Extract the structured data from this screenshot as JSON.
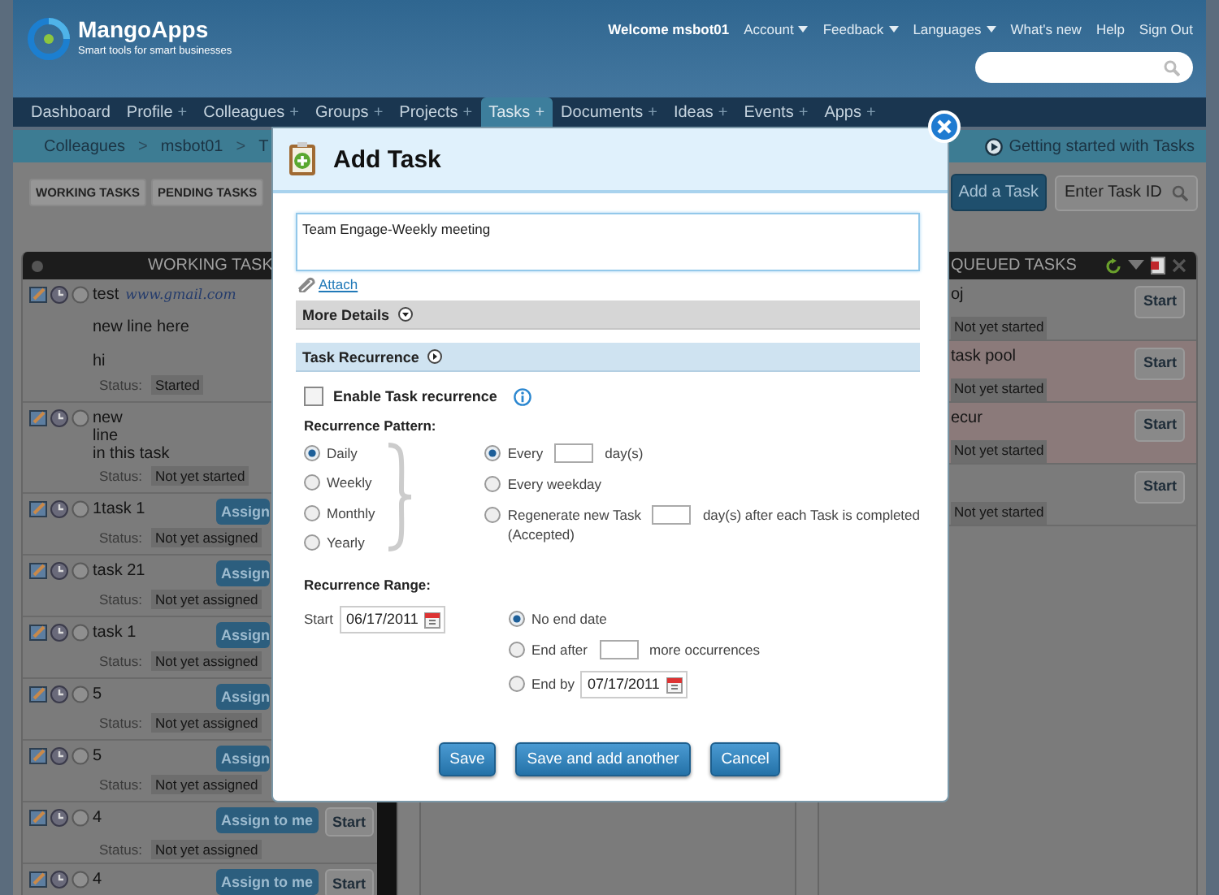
{
  "header": {
    "logo": {
      "name": "MangoApps",
      "tagline": "Smart tools for smart businesses"
    },
    "welcome": "Welcome",
    "user": "msbot01",
    "links": [
      {
        "label": "Account",
        "dropdown": true
      },
      {
        "label": "Feedback",
        "dropdown": true
      },
      {
        "label": "Languages",
        "dropdown": true
      },
      {
        "label": "What's new",
        "dropdown": false
      },
      {
        "label": "Help",
        "dropdown": false
      },
      {
        "label": "Sign Out",
        "dropdown": false
      }
    ]
  },
  "nav": [
    {
      "label": "Dashboard",
      "selected": false
    },
    {
      "label": "Profile",
      "plus": "+",
      "selected": false
    },
    {
      "label": "Colleagues",
      "plus": "+",
      "selected": false
    },
    {
      "label": "Groups",
      "plus": "+",
      "selected": false
    },
    {
      "label": "Projects",
      "plus": "+",
      "selected": false
    },
    {
      "label": "Tasks",
      "plus": "+",
      "selected": true
    },
    {
      "label": "Documents",
      "plus": "+",
      "selected": false
    },
    {
      "label": "Ideas",
      "plus": "+",
      "selected": false
    },
    {
      "label": "Events",
      "plus": "+",
      "selected": false
    },
    {
      "label": "Apps",
      "plus": "+",
      "selected": false
    }
  ],
  "breadcrumb": [
    {
      "kind": "link",
      "label": "Colleagues"
    },
    {
      "kind": "sep",
      "label": ">"
    },
    {
      "kind": "link",
      "label": "msbot01"
    },
    {
      "kind": "sep",
      "label": ">"
    },
    {
      "kind": "link",
      "label": "T"
    }
  ],
  "getting_started": "Getting started with Tasks",
  "toolbar": {
    "views": [
      "WORKING TASKS",
      "PENDING TASKS"
    ],
    "add_button": "Add a Task",
    "task_id": {
      "placeholder": "Enter Task ID"
    }
  },
  "working_panel": {
    "title": "WORKING TASK",
    "tasks": [
      {
        "title": "test",
        "link": "www.gmail.com",
        "description": "new line here\n\nhi",
        "status_label": "Status:",
        "status": "Started"
      },
      {
        "title": "new\nline\nin this task",
        "status_label": "Status:",
        "status": "Not yet started"
      },
      {
        "title": "1task 1",
        "assign": "Assign",
        "status_label": "Status:",
        "status": "Not yet assigned"
      },
      {
        "title": "task 21",
        "assign": "Assign",
        "status_label": "Status:",
        "status": "Not yet assigned"
      },
      {
        "title": "task 1",
        "assign": "Assign",
        "status_label": "Status:",
        "status": "Not yet assigned"
      },
      {
        "title": "5",
        "assign": "Assign",
        "status_label": "Status:",
        "status": "Not yet assigned"
      },
      {
        "title": "5",
        "assign": "Assign",
        "status_label": "Status:",
        "status": "Not yet assigned"
      },
      {
        "title": "4",
        "assign": "Assign to me",
        "start": "Start",
        "status_label": "Status:",
        "status": "Not yet assigned"
      },
      {
        "title": "4",
        "assign": "Assign to me",
        "start": "Start"
      }
    ]
  },
  "queued_panel": {
    "title": "QUEUED TASKS",
    "tasks": [
      {
        "title": "oj",
        "start": "Start",
        "status": "Not yet started",
        "highlight": false
      },
      {
        "title": "task pool",
        "start": "Start",
        "status": "Not yet started",
        "highlight": true
      },
      {
        "title": "ecur",
        "start": "Start",
        "status": "Not yet started",
        "highlight": true
      },
      {
        "start": "Start",
        "status": "Not yet started",
        "highlight": false
      }
    ]
  },
  "dialog": {
    "title": "Add Task",
    "task_text": "Team Engage-Weekly meeting",
    "attach": "Attach",
    "sections": [
      {
        "label": "More Details",
        "expanded": false
      },
      {
        "label": "Task Recurrence",
        "expanded": true
      }
    ],
    "enable_recurrence": {
      "label": "Enable Task recurrence",
      "checked": false
    },
    "pattern": {
      "title": "Recurrence Pattern:",
      "options": [
        {
          "label": "Daily",
          "selected": true
        },
        {
          "label": "Weekly",
          "selected": false
        },
        {
          "label": "Monthly",
          "selected": false
        },
        {
          "label": "Yearly",
          "selected": false
        }
      ],
      "daily_options": [
        {
          "kind": "field",
          "before": "Every",
          "after": "day(s)",
          "selected": true
        },
        {
          "kind": "plain",
          "before": "Every weekday",
          "selected": false
        },
        {
          "kind": "field",
          "before": "Regenerate new Task",
          "after": "day(s) after each Task is completed",
          "note": "(Accepted)",
          "selected": false
        }
      ]
    },
    "range": {
      "title": "Recurrence Range:",
      "start_label": "Start",
      "start_date": "06/17/2011",
      "end_options": [
        {
          "kind": "plain",
          "before": "No end date",
          "selected": true
        },
        {
          "kind": "field",
          "before": "End after",
          "after": "more occurrences",
          "selected": false
        },
        {
          "kind": "date",
          "before": "End by",
          "date": "07/17/2011",
          "selected": false
        }
      ]
    },
    "buttons": [
      "Save",
      "Save and add another",
      "Cancel"
    ]
  }
}
